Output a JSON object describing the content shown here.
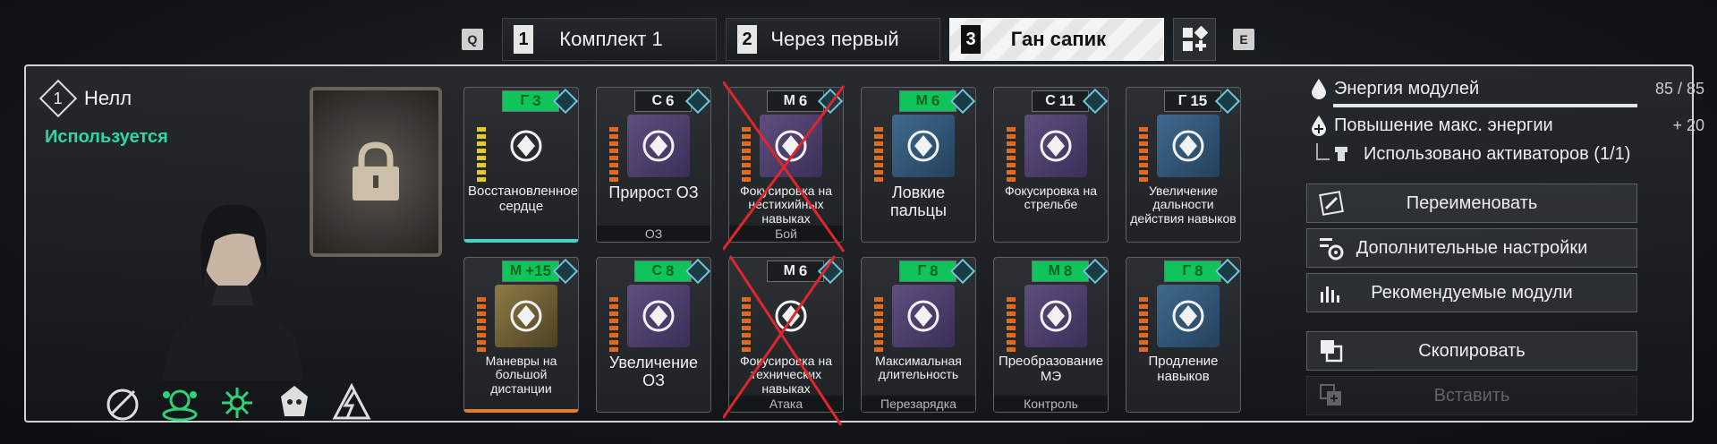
{
  "tabs": {
    "prev_key": "Q",
    "next_key": "E",
    "items": [
      {
        "num": "1",
        "label": "Комплект 1"
      },
      {
        "num": "2",
        "label": "Через первый"
      },
      {
        "num": "3",
        "label": "Ган сапик"
      }
    ],
    "active_index": 2,
    "add_icon": "grid-plus-icon"
  },
  "character": {
    "slot_num": "1",
    "name": "Нелл",
    "status": "Используется",
    "status_color": "#2fd7a3"
  },
  "locked_slot": {
    "icon": "lock-icon"
  },
  "modules": [
    {
      "cost": "3",
      "cost_icon": "Γ",
      "green": true,
      "name": "Восстановленное сердце",
      "type": "",
      "icon_color": "dark",
      "bar": "yellow",
      "bottom": "teal"
    },
    {
      "cost": "6",
      "cost_icon": "C",
      "green": false,
      "name": "Прирост ОЗ",
      "type": "ОЗ",
      "icon_color": "purple",
      "bar": "orange",
      "bottom": ""
    },
    {
      "cost": "6",
      "cost_icon": "M",
      "green": false,
      "name": "Фокусировка на нестихийных навыках",
      "type": "Бой",
      "icon_color": "purple",
      "bar": "orange",
      "bottom": "",
      "crossed": true
    },
    {
      "cost": "6",
      "cost_icon": "M",
      "green": true,
      "name": "Ловкие пальцы",
      "type": "",
      "icon_color": "blue",
      "bar": "orange",
      "bottom": ""
    },
    {
      "cost": "11",
      "cost_icon": "C",
      "green": false,
      "name": "Фокусировка на стрельбе",
      "type": "",
      "icon_color": "purple",
      "bar": "orange",
      "bottom": ""
    },
    {
      "cost": "15",
      "cost_icon": "Γ",
      "green": false,
      "name": "Увеличение дальности действия навыков",
      "type": "",
      "icon_color": "blue",
      "bar": "orange",
      "bottom": ""
    },
    {
      "cost": "+15",
      "cost_icon": "M",
      "green": true,
      "name": "Маневры на большой дистанции",
      "type": "",
      "icon_color": "gold",
      "bar": "orange",
      "bottom": "orange"
    },
    {
      "cost": "8",
      "cost_icon": "C",
      "green": true,
      "name": "Увеличение ОЗ",
      "type": "",
      "icon_color": "purple",
      "bar": "orange",
      "bottom": ""
    },
    {
      "cost": "6",
      "cost_icon": "M",
      "green": false,
      "name": "Фокусировка на технических навыках",
      "type": "Атака",
      "icon_color": "dark",
      "bar": "orange",
      "bottom": "",
      "crossed": true
    },
    {
      "cost": "8",
      "cost_icon": "Γ",
      "green": true,
      "name": "Максимальная длительность",
      "type": "Перезарядка",
      "icon_color": "purple",
      "bar": "orange",
      "bottom": ""
    },
    {
      "cost": "8",
      "cost_icon": "M",
      "green": true,
      "name": "Преобразование МЭ",
      "type": "Контроль",
      "icon_color": "purple",
      "bar": "orange",
      "bottom": ""
    },
    {
      "cost": "8",
      "cost_icon": "Γ",
      "green": true,
      "name": "Продление навыков",
      "type": "",
      "icon_color": "blue",
      "bar": "orange",
      "bottom": ""
    }
  ],
  "stats": {
    "energy_label": "Энергия модулей",
    "energy_value": "85 / 85",
    "energy_fraction": 1.0,
    "max_energy_label": "Повышение макс. энергии",
    "max_energy_value": "+ 20",
    "activators_label": "Использовано активаторов (1/1)"
  },
  "actions": {
    "rename": "Переименовать",
    "extra_settings": "Дополнительные настройки",
    "recommended": "Рекомендуемые модули",
    "copy": "Скопировать",
    "paste": "Вставить"
  },
  "skill_icons": [
    "skill-icon-1",
    "skill-icon-2",
    "skill-icon-3",
    "skill-icon-4",
    "skill-icon-5"
  ]
}
